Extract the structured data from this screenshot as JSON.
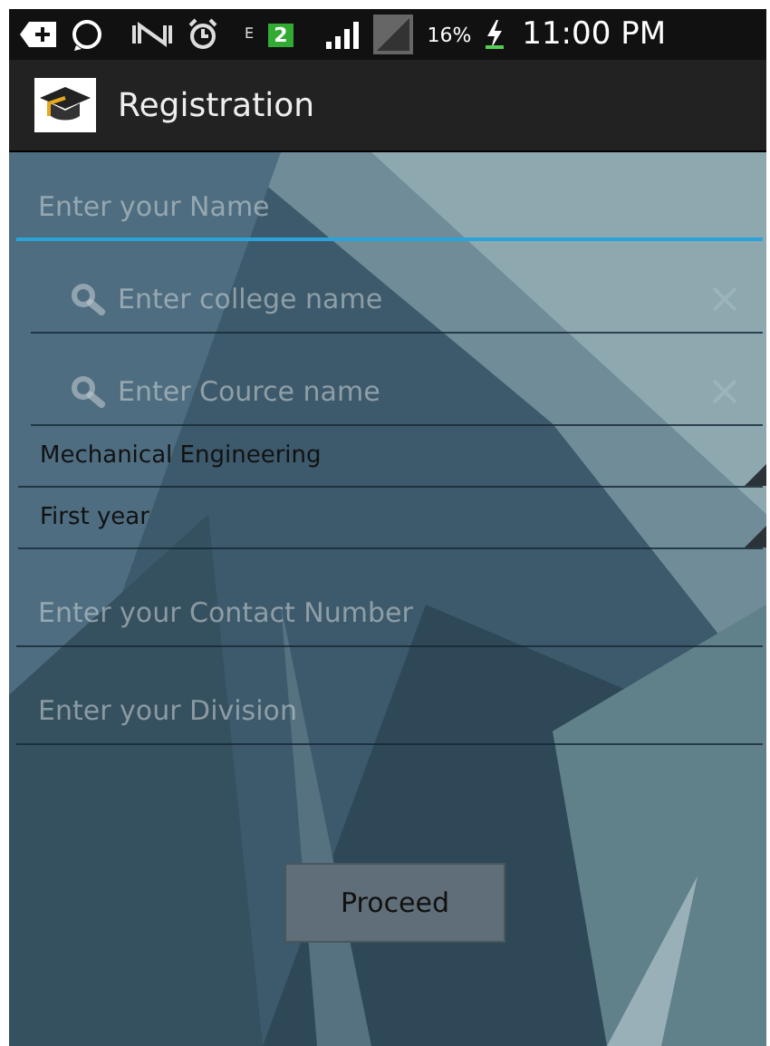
{
  "status_bar": {
    "network_type": "E",
    "sim_slot": "2",
    "battery": "16%",
    "time": "11:00 PM"
  },
  "app_bar": {
    "title": "Registration"
  },
  "form": {
    "fields": [
      {
        "kind": "text",
        "placeholder": "Enter your Name",
        "focused": true
      },
      {
        "kind": "search",
        "placeholder": "Enter college name",
        "focused": false
      },
      {
        "kind": "search",
        "placeholder": "Enter Cource name",
        "focused": false
      },
      {
        "kind": "spinner",
        "value": "Mechanical Engineering"
      },
      {
        "kind": "spinner",
        "value": "First year"
      },
      {
        "kind": "text",
        "placeholder": "Enter your Contact Number",
        "focused": false
      },
      {
        "kind": "text",
        "placeholder": "Enter your Division",
        "focused": false
      }
    ],
    "button": "Proceed"
  }
}
